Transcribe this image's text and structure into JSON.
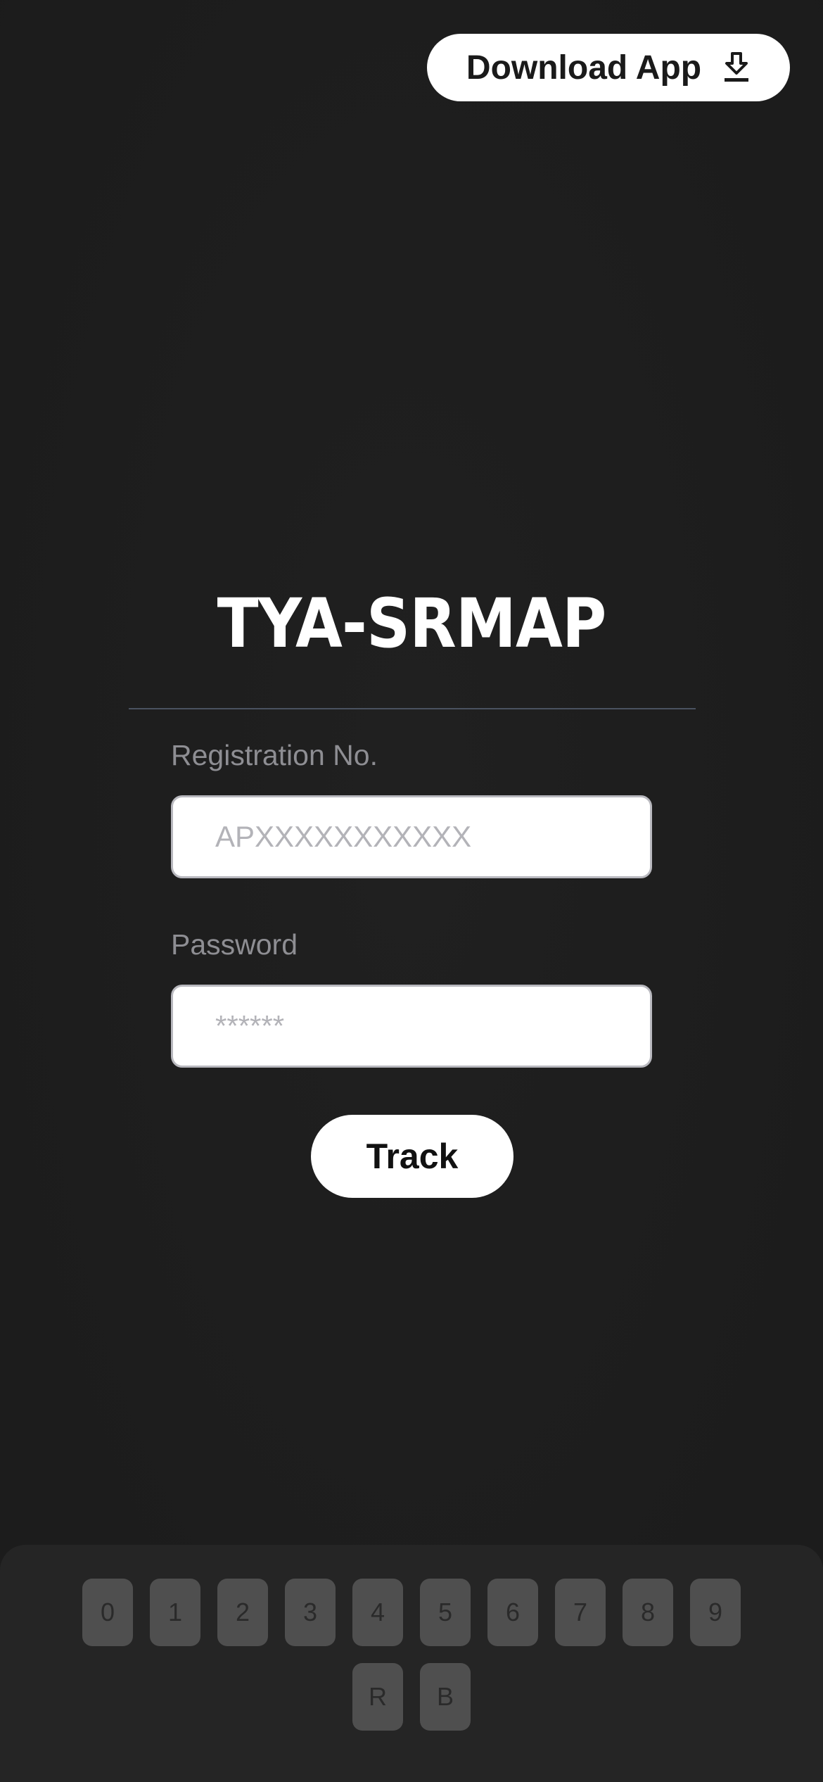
{
  "header": {
    "download_label": "Download App",
    "download_icon": "download-icon"
  },
  "brand": {
    "title": "TYA-SRMAP"
  },
  "form": {
    "registration": {
      "label": "Registration No.",
      "placeholder": "APXXXXXXXXXXX",
      "value": ""
    },
    "password": {
      "label": "Password",
      "placeholder": "******",
      "value": ""
    },
    "submit_label": "Track"
  },
  "keypad": {
    "row1": [
      "0",
      "1",
      "2",
      "3",
      "4",
      "5",
      "6",
      "7",
      "8",
      "9"
    ],
    "row2": [
      "R",
      "B"
    ]
  },
  "colors": {
    "background": "#1e1e1e",
    "keypad_bg": "#252525",
    "key_bg": "#4f4f4f",
    "button_bg": "#ffffff",
    "label": "#8e8e93"
  }
}
